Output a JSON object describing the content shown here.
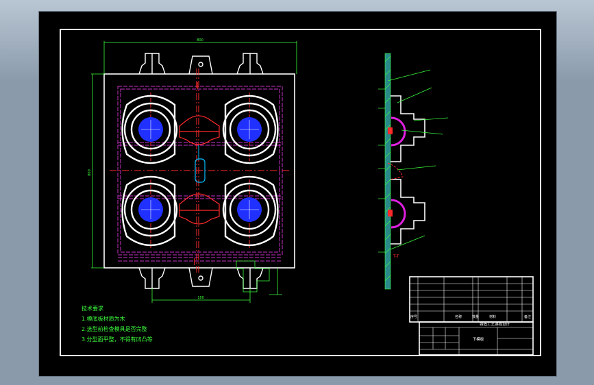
{
  "notes": {
    "heading": "技术要求",
    "items": [
      "1.模底板材质为木",
      "2.选型前检查模具是否完整",
      "3.分型面平整，不得有凹凸等"
    ]
  },
  "dims": {
    "top_width": "800",
    "left_height": "800",
    "bottom_width": "180"
  },
  "section_label": "T-T",
  "title_block": {
    "title": "铸造工艺课程设计",
    "drawing_name": "下模板",
    "col_headers": [
      "序号",
      "名称",
      "数量",
      "材料",
      "备注"
    ]
  },
  "colors": {
    "sheet": "#000000",
    "outline": "#ffffff",
    "center_line": "#ff2a2a",
    "dimension": "#3cff3c",
    "parting_line": "#c830c8",
    "core": "#2030ff",
    "highlight": "#00bfff"
  }
}
